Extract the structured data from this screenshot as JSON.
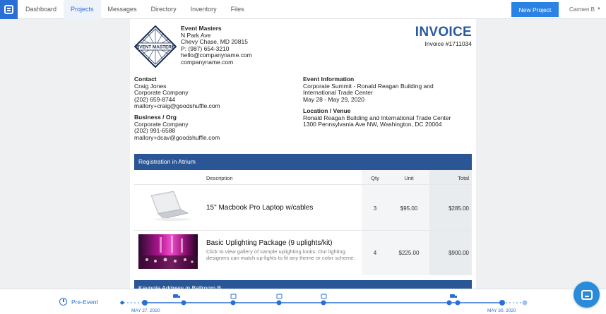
{
  "nav": {
    "items": [
      {
        "label": "Dashboard",
        "active": false
      },
      {
        "label": "Projects",
        "active": true
      },
      {
        "label": "Messages",
        "active": false
      },
      {
        "label": "Directory",
        "active": false
      },
      {
        "label": "Inventory",
        "active": false
      },
      {
        "label": "Files",
        "active": false
      }
    ],
    "new_project_label": "New Project",
    "user_name": "Carmen B",
    "accent": "#2a6fd6"
  },
  "invoice": {
    "title": "INVOICE",
    "number": "Invoice #1711034",
    "logo_text": "EVENT MASTERS",
    "company": {
      "name": "Event Masters",
      "address1": "N Park Ave",
      "address2": "Chevy Chase, MD 20815",
      "phone": "P: (987) 654-3210",
      "email": "hello@companyname.com",
      "website": "companyname.com"
    },
    "contact": {
      "heading": "Contact",
      "name": "Craig Jones",
      "company": "Corporate Company",
      "phone": "(202) 659-8744",
      "email": "mallory+craig@goodshuffle.com"
    },
    "business": {
      "heading": "Business / Org",
      "company": "Corporate Company",
      "phone": "(202) 991-6588",
      "email": "mallory+dcav@goodshuffle.com"
    },
    "event": {
      "heading": "Event Information",
      "line1": "Corporate Summit - Ronald Reagan Building and",
      "line2": "International Trade Center",
      "dates": "May 28 - May 29, 2020"
    },
    "venue": {
      "heading": "Location / Venue",
      "line1": "Ronald Reagan Building and International Trade Center",
      "line2": "1300 Pennsylvania Ave NW, Washington, DC 20004"
    },
    "sections": [
      {
        "title": "Registration in Atrium"
      },
      {
        "title": "Keynote Address in Ballroom B"
      }
    ],
    "columns": {
      "description": "Description",
      "qty": "Qty",
      "unit": "Unit",
      "total": "Total"
    },
    "items": [
      {
        "title": "15\" Macbook Pro Laptop w/cables",
        "description": "",
        "qty": "3",
        "unit": "$95.00",
        "total": "$285.00",
        "thumb": "laptop-image"
      },
      {
        "title": "Basic Uplighting Package (9 uplights/kit)",
        "description": "Click to view gallery of sample uplighting looks. Our lighting designers can match up-lights to fit any theme or color scheme.",
        "qty": "4",
        "unit": "$225.00",
        "total": "$900.00",
        "thumb": "uplighting-image"
      }
    ],
    "header_blue": "#2a5696"
  },
  "timeline": {
    "label": "Pre-Event",
    "start_date": "MAY 27, 2020",
    "end_date": "MAY 30, 2020",
    "icons": [
      "truck-icon",
      "calendar-icon",
      "calendar-icon",
      "calendar-icon",
      "truck-icon"
    ]
  }
}
